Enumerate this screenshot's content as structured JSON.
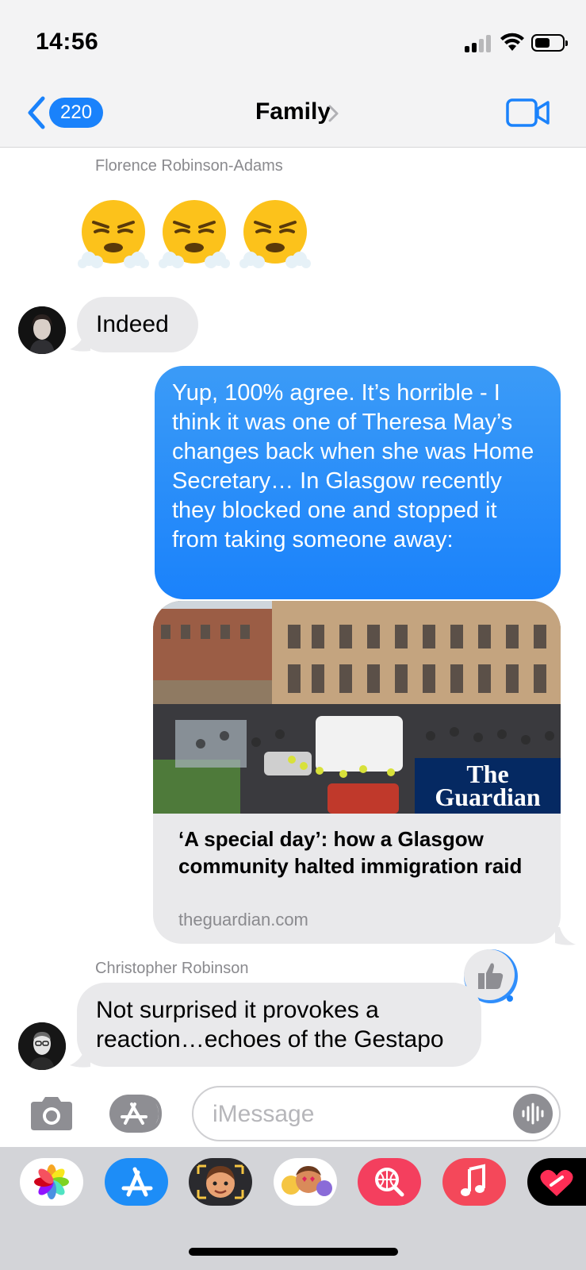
{
  "status_bar": {
    "time": "14:56"
  },
  "nav": {
    "back_count": "220",
    "title": "Family"
  },
  "messages": {
    "sender_1": "Florence Robinson-Adams",
    "emoji_1": "face-with-steam-from-nose",
    "reply_1": "Indeed",
    "outgoing_text": "Yup, 100% agree. It’s horrible - I think it was one of Theresa May’s changes back when she was Home Secretary… In Glasgow recently they blocked one and stopped it from taking someone away:",
    "link": {
      "title": "‘A special day’: how a Glasgow community halted immigration raid",
      "domain": "theguardian.com",
      "logo_line1": "The",
      "logo_line2": "Guardian"
    },
    "sender_2": "Christopher Robinson",
    "reply_2": "Not surprised it provokes a reaction…echoes of the Gestapo",
    "tapback": "thumbs-up"
  },
  "composer": {
    "placeholder": "iMessage"
  },
  "app_drawer": {
    "apps": [
      "photos-icon",
      "app-store-icon",
      "memoji-icon",
      "animoji-stickers-icon",
      "web-search-icon",
      "music-icon",
      "digital-touch-icon"
    ]
  },
  "colors": {
    "outgoing_bubble": "#1a82fb",
    "incoming_bubble": "#e9e9eb",
    "accent": "#1a82fb"
  }
}
